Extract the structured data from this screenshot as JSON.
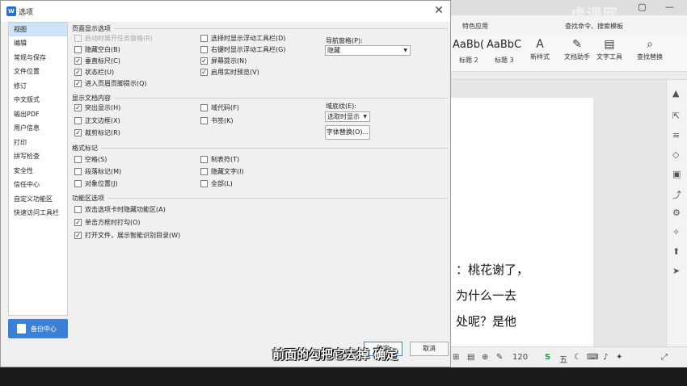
{
  "dialog": {
    "title": "选项",
    "close_glyph": "✕",
    "ok_label": "确定",
    "cancel_label": "取消",
    "backup_label": "备份中心"
  },
  "nav": {
    "items": [
      "视图",
      "编辑",
      "常规与保存",
      "文件位置",
      "修订",
      "中文版式",
      "输出PDF",
      "用户信息",
      "打印",
      "拼写检查",
      "安全性",
      "信任中心",
      "自定义功能区",
      "快速访问工具栏"
    ],
    "active": "视图"
  },
  "sections": {
    "page_display": {
      "title": "页面显示选项",
      "left": [
        {
          "label": "启动时展开任务窗格(R)",
          "checked": false,
          "disabled": true
        },
        {
          "label": "隐藏空白(B)",
          "checked": false
        },
        {
          "label": "垂直标尺(C)",
          "checked": true
        },
        {
          "label": "状态栏(U)",
          "checked": true
        },
        {
          "label": "进入页眉页脚提示(Q)",
          "checked": true
        }
      ],
      "right": [
        {
          "label": "选择时显示浮动工具栏(D)",
          "checked": false
        },
        {
          "label": "右键时显示浮动工具栏(G)",
          "checked": false
        },
        {
          "label": "屏幕提示(N)",
          "checked": true
        },
        {
          "label": "启用实时预览(V)",
          "checked": true
        }
      ],
      "nav_pane_label": "导航窗格(P):",
      "nav_pane_value": "隐藏"
    },
    "doc_content": {
      "title": "显示文档内容",
      "left": [
        {
          "label": "突出显示(H)",
          "checked": true
        },
        {
          "label": "正文边框(X)",
          "checked": false
        },
        {
          "label": "裁剪标记(R)",
          "checked": true
        }
      ],
      "right": [
        {
          "label": "域代码(F)",
          "checked": false
        },
        {
          "label": "书签(K)",
          "checked": false
        }
      ],
      "shading_label": "域底纹(E):",
      "shading_value": "选取时显示",
      "font_sub_label": "字体替换(O)..."
    },
    "format_marks": {
      "title": "格式标记",
      "left": [
        {
          "label": "空格(S)",
          "checked": false
        },
        {
          "label": "段落标记(M)",
          "checked": false
        },
        {
          "label": "对象位置(J)",
          "checked": false
        }
      ],
      "right": [
        {
          "label": "制表符(T)",
          "checked": false
        },
        {
          "label": "隐藏文字(I)",
          "checked": false
        },
        {
          "label": "全部(L)",
          "checked": false
        }
      ]
    },
    "ribbon": {
      "title": "功能区选项",
      "items": [
        {
          "label": "双击选项卡时隐藏功能区(A)",
          "checked": false
        },
        {
          "label": "单击方框时打勾(O)",
          "checked": true
        },
        {
          "label": "打开文件，展示智能识别目录(W)",
          "checked": true
        }
      ]
    }
  },
  "background": {
    "tab_feature": "特色应用",
    "tab_find": "查找命令、搜索模板",
    "style_samples": [
      "AaBb(",
      "AaBbC"
    ],
    "style_captions": [
      "标题 2",
      "标题 3"
    ],
    "ribbon_buttons": [
      {
        "label": "新样式",
        "icon": "style-icon"
      },
      {
        "label": "文档助手",
        "icon": "assistant-icon"
      },
      {
        "label": "文字工具",
        "icon": "text-tool-icon"
      },
      {
        "label": "查找替换",
        "icon": "find-replace-icon"
      }
    ],
    "doc_lines": [
      "：桃花谢了，",
      "为什么一去",
      "处呢？是他"
    ],
    "status_zoom": "120",
    "ime_label": "五",
    "watermark": "虎课网"
  },
  "subtitle": "前面的勾把它去掉 确定",
  "colors": {
    "accent": "#3c7fd6",
    "nav_active": "#cde3f7"
  }
}
